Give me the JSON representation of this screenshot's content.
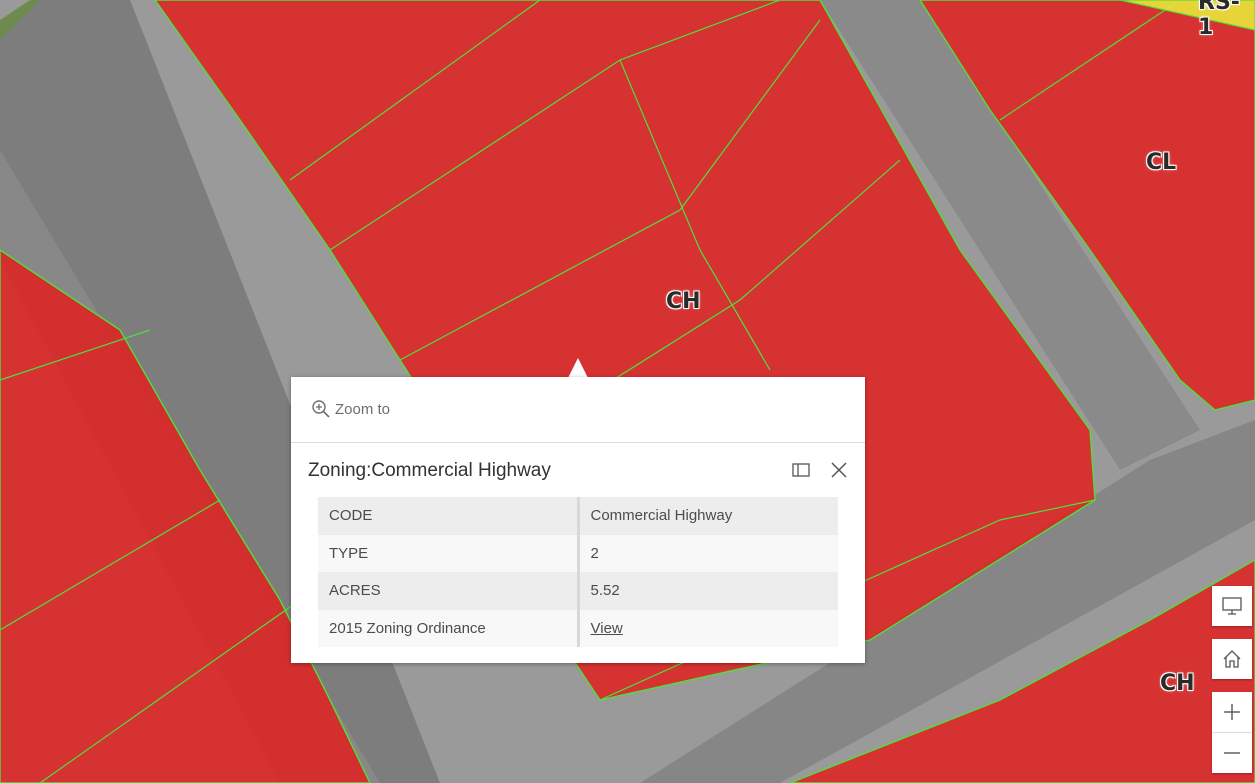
{
  "map": {
    "zone_labels": [
      "CH",
      "CL",
      "CH",
      "RS-1"
    ],
    "zone_fill_color": "#e02020",
    "boundary_color": "#4fe03a",
    "residential_fill_color": "#e8e63a"
  },
  "popup": {
    "zoom_to_label": "Zoom to",
    "title": "Zoning:Commercial Highway",
    "rows": [
      {
        "key": "CODE",
        "value": "Commercial Highway"
      },
      {
        "key": "TYPE",
        "value": "2"
      },
      {
        "key": "ACRES",
        "value": "5.52"
      },
      {
        "key": "2015 Zoning Ordinance",
        "value": "View"
      }
    ]
  },
  "widgets": {
    "icons": [
      "monitor-icon",
      "home-icon",
      "plus-icon",
      "minus-icon"
    ]
  }
}
